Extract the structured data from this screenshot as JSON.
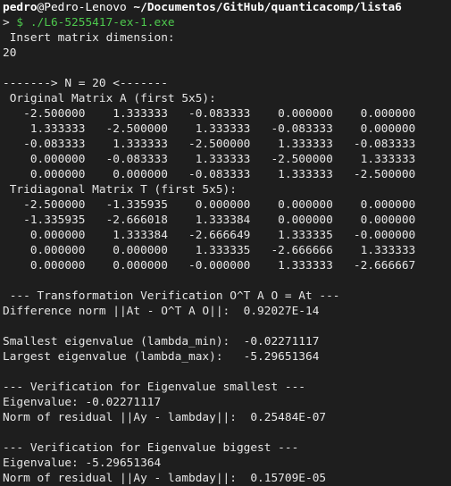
{
  "title_line": {
    "user": "pedro",
    "at_host": "@Pedro-Lenovo",
    "path": " ~/Documentos/GitHub/quanticacomp/lista6"
  },
  "command_line": {
    "prompt": "> ",
    "command": "$ ./L6-5255417-ex-1.exe"
  },
  "output_lines": [
    " Insert matrix dimension:",
    "20",
    "",
    "-------> N = 20 <-------",
    " Original Matrix A (first 5x5):",
    "   -2.500000    1.333333   -0.083333    0.000000    0.000000",
    "    1.333333   -2.500000    1.333333   -0.083333    0.000000",
    "   -0.083333    1.333333   -2.500000    1.333333   -0.083333",
    "    0.000000   -0.083333    1.333333   -2.500000    1.333333",
    "    0.000000    0.000000   -0.083333    1.333333   -2.500000",
    " Tridiagonal Matrix T (first 5x5):",
    "   -2.500000   -1.335935    0.000000    0.000000    0.000000",
    "   -1.335935   -2.666018    1.333384    0.000000    0.000000",
    "    0.000000    1.333384   -2.666649    1.333335   -0.000000",
    "    0.000000    0.000000    1.333335   -2.666666    1.333333",
    "    0.000000    0.000000   -0.000000    1.333333   -2.666667",
    "",
    " --- Transformation Verification O^T A O = At ---",
    "Difference norm ||At - O^T A O||:  0.92027E-14",
    "",
    "Smallest eigenvalue (lambda_min):  -0.02271117",
    "Largest eigenvalue (lambda_max):   -5.29651364",
    "",
    "--- Verification for Eigenvalue smallest ---",
    "Eigenvalue: -0.02271117",
    "Norm of residual ||Ay - lambday||:  0.25484E-07",
    "",
    "--- Verification for Eigenvalue biggest ---",
    "Eigenvalue: -5.29651364",
    "Norm of residual ||Ay - lambday||:  0.15709E-05"
  ]
}
